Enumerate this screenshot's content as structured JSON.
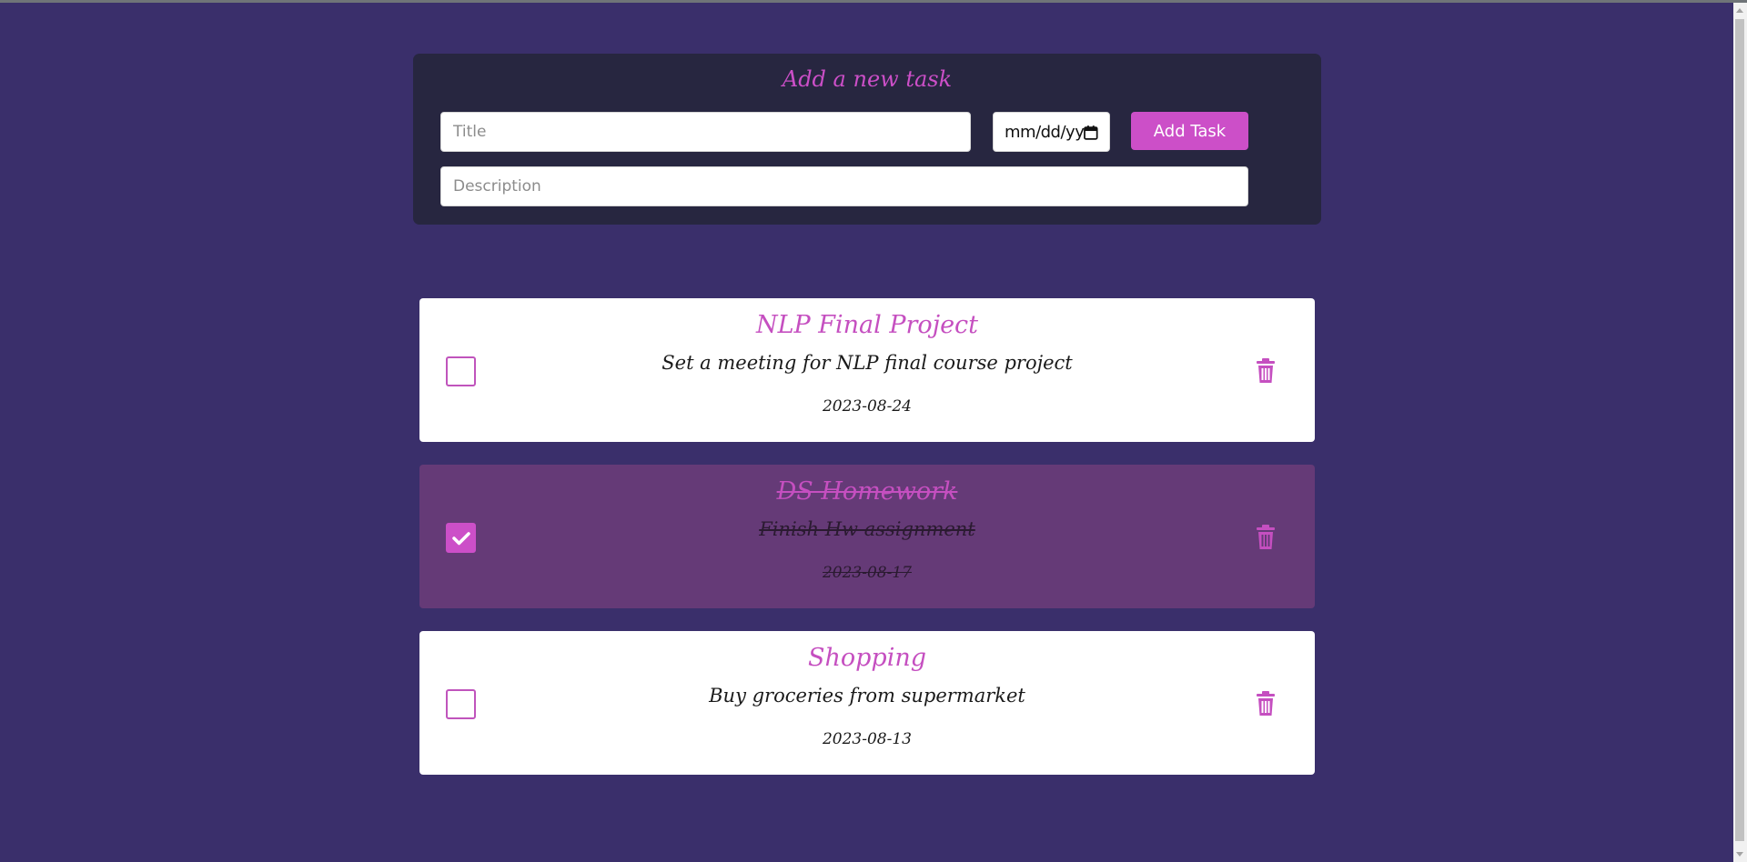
{
  "form": {
    "heading": "Add a new task",
    "title_placeholder": "Title",
    "date_placeholder": "mm/dd/yy",
    "add_button_label": "Add Task",
    "description_placeholder": "Description"
  },
  "tasks": [
    {
      "title": "NLP Final Project",
      "description": "Set a meeting for NLP final course project",
      "date": "2023-08-24",
      "completed": false
    },
    {
      "title": "DS Homework",
      "description": "Finish Hw assignment",
      "date": "2023-08-17",
      "completed": true
    },
    {
      "title": "Shopping",
      "description": "Buy groceries from supermarket",
      "date": "2023-08-13",
      "completed": false
    }
  ],
  "icons": {
    "calendar": "calendar-icon",
    "delete": "trash-icon",
    "check": "checkmark-icon"
  },
  "colors": {
    "background": "#3a2f6b",
    "panel": "#272640",
    "accent": "#cc4fc8",
    "completed_card": "#653a77"
  }
}
